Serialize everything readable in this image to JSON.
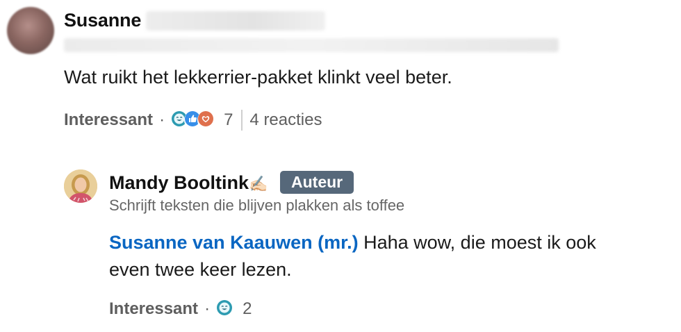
{
  "comment": {
    "author_name": "Susanne",
    "text": "Wat ruikt het lekkerrier-pakket klinkt veel beter.",
    "reaction_label": "Interessant",
    "separator": "·",
    "reaction_count": "7",
    "replies_label": "4 reacties",
    "reaction_icons": [
      "insightful-icon",
      "like-icon",
      "love-icon"
    ]
  },
  "reply": {
    "author_name": "Mandy Booltink",
    "author_badge": "Auteur",
    "headline": "Schrijft teksten die blijven plakken als toffee",
    "mention": "Susanne van Kaauwen (mr.)",
    "text": " Haha wow, die moest ik ook even twee keer lezen.",
    "reaction_label": "Interessant",
    "separator": "·",
    "reaction_count": "2",
    "reaction_icons": [
      "insightful-icon"
    ]
  },
  "colors": {
    "mention": "#0a66c2",
    "badge": "#56687a",
    "insightful": "#2d9bb1",
    "like": "#378fe9",
    "love": "#df704d"
  }
}
